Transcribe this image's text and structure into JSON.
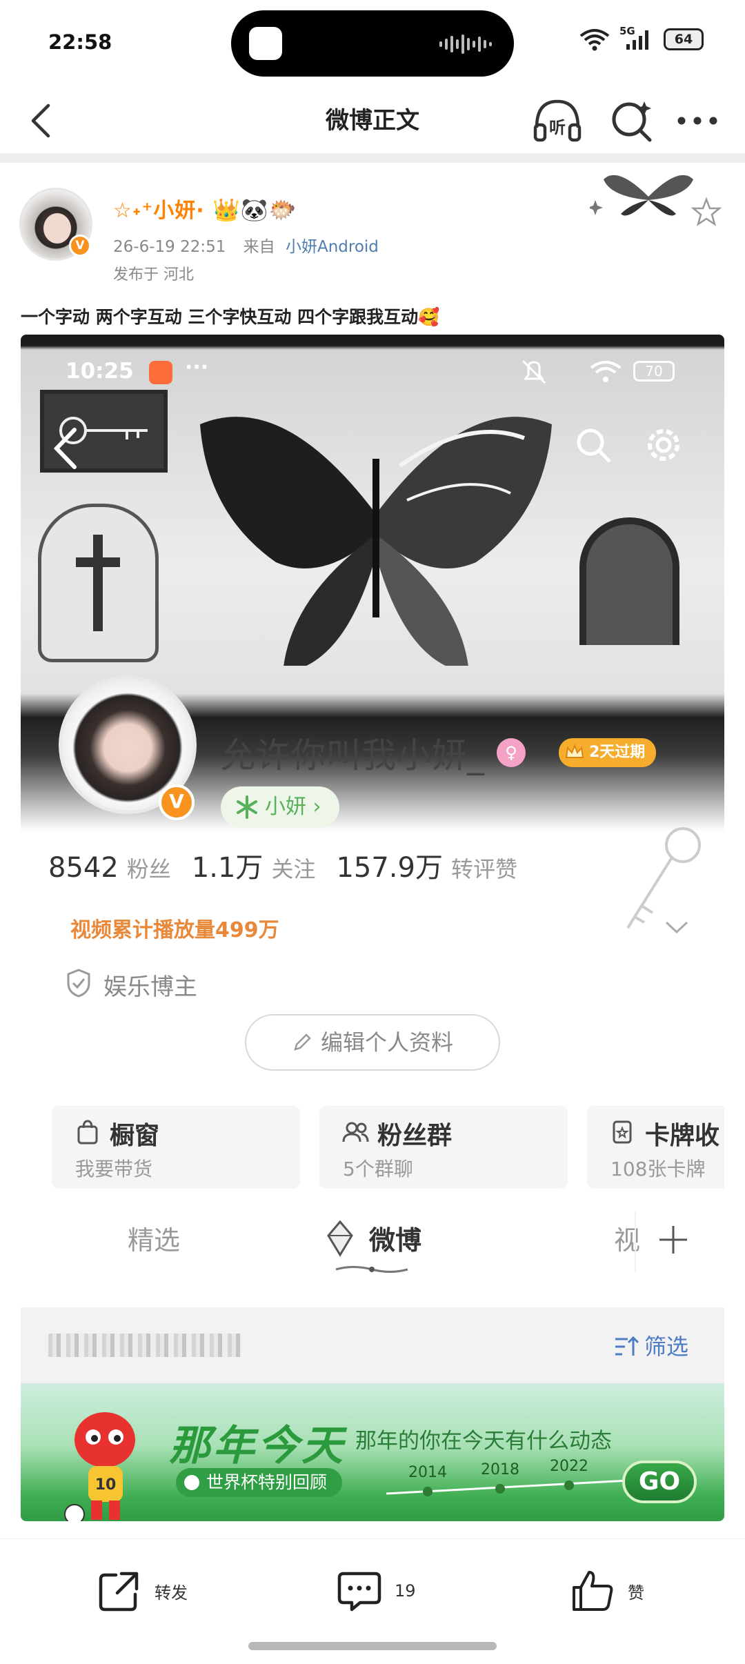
{
  "status_bar": {
    "time": "22:58",
    "battery": "64",
    "network": "5G"
  },
  "nav": {
    "title": "微博正文",
    "listen_label": "听"
  },
  "post": {
    "author": "☆˖⁺小妍·",
    "date": "26-6-19 22:51",
    "source_prefix": "来自",
    "source": "小妍Android",
    "location": "发布于 河北",
    "text": "一个字动 两个字互动 三个字快互动 四个字跟我互动🥰"
  },
  "embed": {
    "status_time": "10:25",
    "status_battery": "70",
    "nickname": "允许你叫我小妍_",
    "vip_label": "2天过期",
    "group_label": "小妍 ›",
    "stats": [
      {
        "num": "8542",
        "label": "粉丝"
      },
      {
        "num": "1.1万",
        "label": "关注"
      },
      {
        "num": "157.9万",
        "label": "转评赞"
      }
    ],
    "video_count": "视频累计播放量499万",
    "entertainment": "娱乐博主",
    "edit_profile": "编辑个人资料",
    "cards": [
      {
        "title": "橱窗",
        "sub": "我要带货"
      },
      {
        "title": "粉丝群",
        "sub": "5个群聊"
      },
      {
        "title": "卡牌收",
        "sub": "108张卡牌"
      }
    ],
    "tabs": {
      "featured": "精选",
      "weibo": "微博",
      "video": "视"
    },
    "filter": "筛选",
    "promo": {
      "title": "那年今天",
      "desc": "那年的你在今天有什么动态",
      "tag": "世界杯特别回顾",
      "years": [
        "2014",
        "2018",
        "2022"
      ],
      "go": "GO",
      "jersey": "10"
    }
  },
  "actions": {
    "repost": "转发",
    "comments": "19",
    "like": "赞"
  },
  "colors": {
    "orange": "#ff8200",
    "link": "#507daf",
    "green": "#2a9a3c"
  }
}
